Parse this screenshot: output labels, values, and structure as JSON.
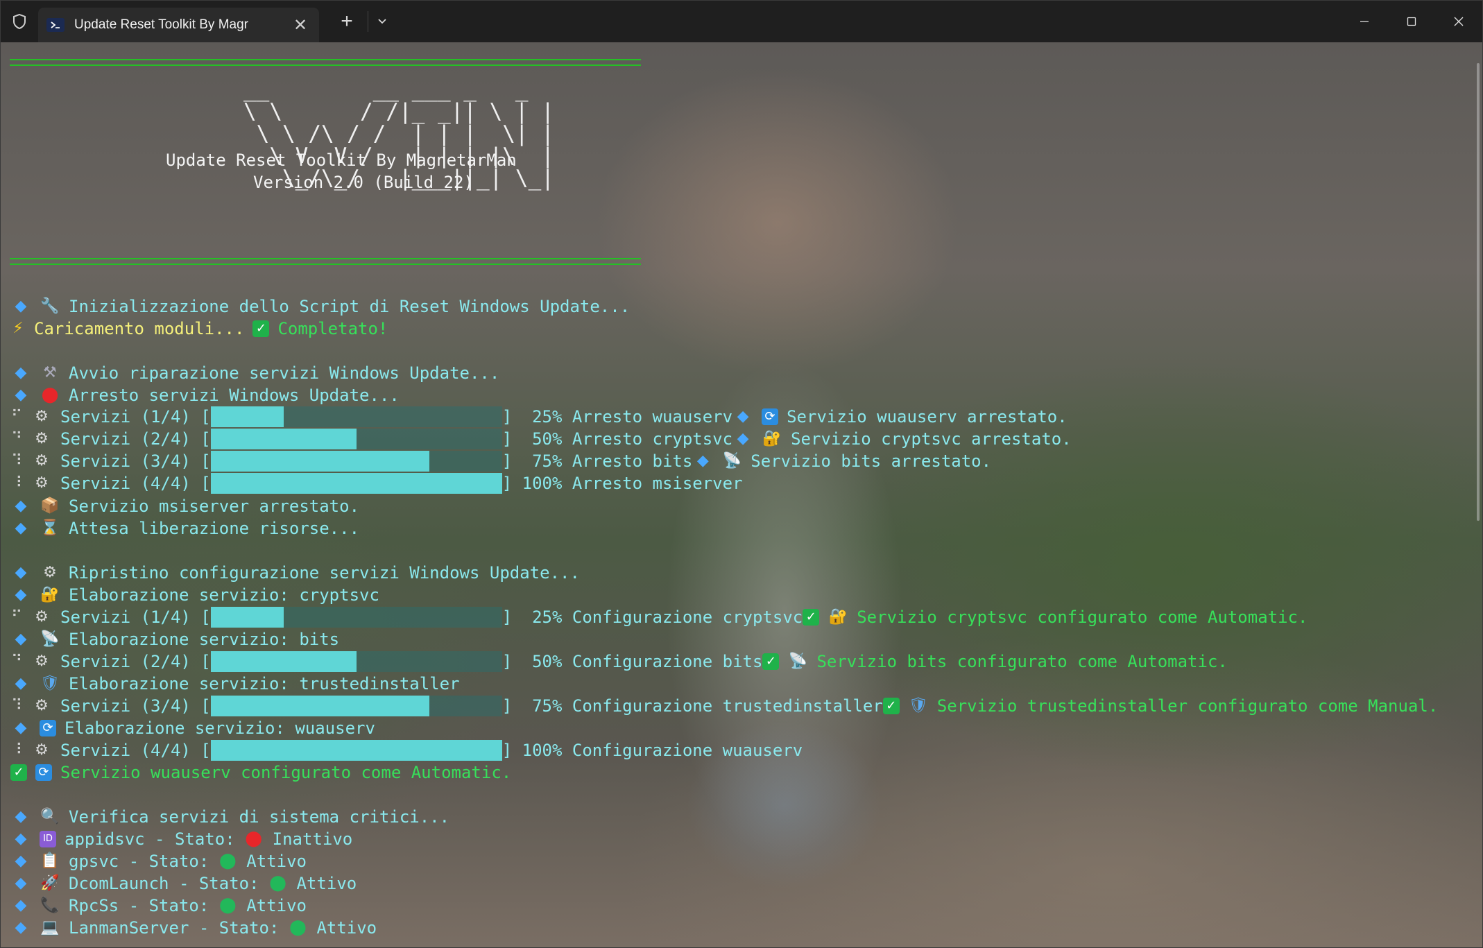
{
  "window": {
    "tab_title": "Update Reset Toolkit By Magr",
    "tab_close": "✕",
    "new_tab": "+",
    "dropdown_icon": "chevron-down-icon",
    "controls": [
      "minimize",
      "maximize",
      "close"
    ]
  },
  "header": {
    "ascii_art": "__        __ ___ _   _\n\\ \\      / /|_ _|| \\ | |\n \\ \\ /\\ / /  | | |  \\| |\n  \\ V  V /   | | | |\\  |\n   \\_/\\_/   |___||_| \\_|",
    "title": "Update Reset Toolkit By MagnetarMan",
    "version": "Version 2.0 (Build 22)"
  },
  "colors": {
    "cyan": "#8ae9ee",
    "yellow": "#f5f07a",
    "green": "#37e05a",
    "bar_fill": "#5fd6d6",
    "rule": "#25c025"
  },
  "lines": {
    "init": "Inizializzazione dello Script di Reset Windows Update...",
    "loading": "Caricamento moduli...",
    "loading_done": "Completato!",
    "repair_start": "Avvio riparazione servizi Windows Update...",
    "stop_start": "Arresto servizi Windows Update...",
    "stop_rows": [
      {
        "label": "Servizi (1/4) [",
        "progress": 0.25,
        "tail": "]  25% Arresto wuauserv",
        "msg": "Servizio wuauserv arrestato."
      },
      {
        "label": "Servizi (2/4) [",
        "progress": 0.5,
        "tail": "]  50% Arresto cryptsvc",
        "msg": "Servizio cryptsvc arrestato."
      },
      {
        "label": "Servizi (3/4) [",
        "progress": 0.75,
        "tail": "]  75% Arresto bits",
        "msg": "Servizio bits arrestato."
      },
      {
        "label": "Servizi (4/4) [",
        "progress": 1.0,
        "tail": "] 100% Arresto msiserver",
        "msg": ""
      }
    ],
    "msiserver_stopped": "Servizio msiserver arrestato.",
    "waiting": "Attesa liberazione risorse...",
    "restore_start": "Ripristino configurazione servizi Windows Update...",
    "elab_cryptsvc": "Elaborazione servizio: cryptsvc",
    "cfg_row1": {
      "label": "Servizi (1/4) [",
      "progress": 0.25,
      "tail": "]  25% Configurazione cryptsvc",
      "msg": "Servizio cryptsvc configurato come Automatic."
    },
    "elab_bits": "Elaborazione servizio: bits",
    "cfg_row2": {
      "label": "Servizi (2/4) [",
      "progress": 0.5,
      "tail": "]  50% Configurazione bits",
      "msg": "Servizio bits configurato come Automatic."
    },
    "elab_trusted": "Elaborazione servizio: trustedinstaller",
    "cfg_row3": {
      "label": "Servizi (3/4) [",
      "progress": 0.75,
      "tail": "]  75% Configurazione trustedinstaller",
      "msg": "Servizio trustedinstaller configurato come Manual."
    },
    "elab_wuauserv": "Elaborazione servizio: wuauserv",
    "cfg_row4": {
      "label": "Servizi (4/4) [",
      "progress": 1.0,
      "tail": "] 100% Configurazione wuauserv",
      "msg": ""
    },
    "wuauserv_cfg": "Servizio wuauserv configurato come Automatic.",
    "verify": "Verifica servizi di sistema critici...",
    "status": [
      {
        "prefix": "appidsvc - Stato:",
        "value": "Inattivo",
        "dot": "#e8262a",
        "icon": "id-icon"
      },
      {
        "prefix": "gpsvc - Stato:",
        "value": "Attivo",
        "dot": "#22b85a",
        "icon": "clipboard-icon"
      },
      {
        "prefix": "DcomLaunch - Stato:",
        "value": "Attivo",
        "dot": "#22b85a",
        "icon": "rocket-icon"
      },
      {
        "prefix": "RpcSs - Stato:",
        "value": "Attivo",
        "dot": "#22b85a",
        "icon": "phone-icon"
      },
      {
        "prefix": "LanmanServer - Stato:",
        "value": "Attivo",
        "dot": "#22b85a",
        "icon": "computer-icon"
      }
    ]
  }
}
